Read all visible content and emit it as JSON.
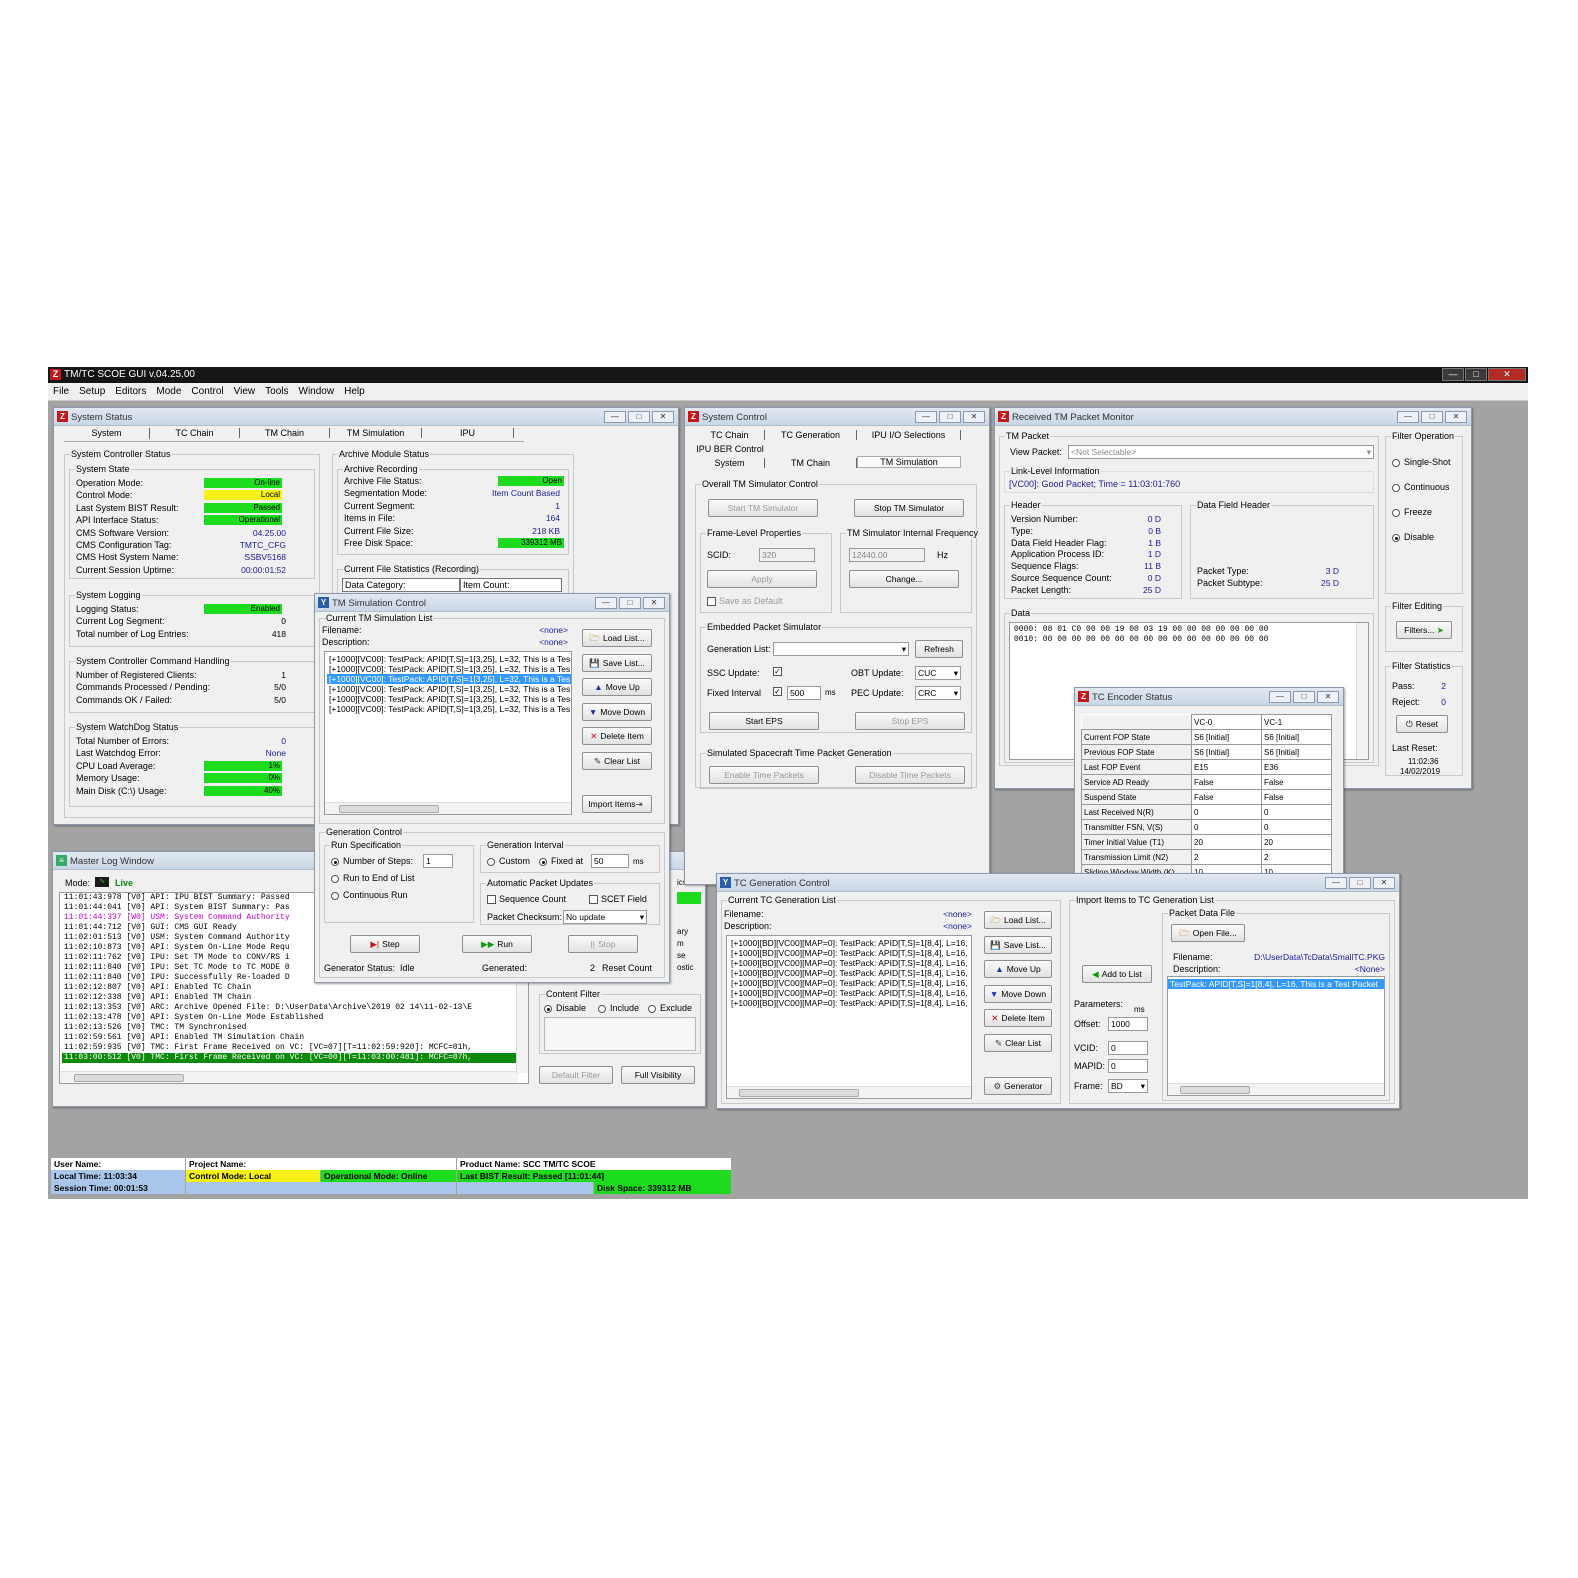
{
  "app": {
    "title": "TM/TC SCOE GUI v.04.25.00",
    "menu": [
      "File",
      "Setup",
      "Editors",
      "Mode",
      "Control",
      "View",
      "Tools",
      "Window",
      "Help"
    ],
    "window_buttons": [
      "—",
      "□",
      "✕"
    ]
  },
  "system_status": {
    "title": "System Status",
    "tabs": [
      "System",
      "TC Chain",
      "TM Chain",
      "TM Simulation",
      "IPU"
    ],
    "controller_status": "System Controller Status",
    "state_group": "System State",
    "state": [
      {
        "label": "Operation Mode:",
        "value": "On-line",
        "color": "green"
      },
      {
        "label": "Control Mode:",
        "value": "Local",
        "color": "yellow"
      },
      {
        "label": "Last System BIST Result:",
        "value": "Passed",
        "color": "green"
      },
      {
        "label": "API Interface Status:",
        "value": "Operational",
        "color": "green"
      },
      {
        "label": "CMS Software Version:",
        "value": "04.25.00",
        "color": ""
      },
      {
        "label": "CMS Configuration Tag:",
        "value": "TMTC_CFG",
        "color": ""
      },
      {
        "label": "CMS Host System Name:",
        "value": "SSBV5168",
        "color": ""
      },
      {
        "label": "Current Session Uptime:",
        "value": "00:00:01:52",
        "color": ""
      }
    ],
    "logging_group": "System Logging",
    "logging": [
      {
        "label": "Logging Status:",
        "value": "Enabled",
        "color": "green"
      },
      {
        "label": "Current Log Segment:",
        "value": "0",
        "color": ""
      },
      {
        "label": "Total number of Log Entries:",
        "value": "418",
        "color": ""
      }
    ],
    "cmd_group": "System Controller Command Handling",
    "cmd": [
      {
        "label": "Number of Registered Clients:",
        "value": "1"
      },
      {
        "label": "Commands Processed / Pending:",
        "value": "5/0"
      },
      {
        "label": "Commands OK / Failed:",
        "value": "5/0"
      }
    ],
    "watchdog_group": "System WatchDog Status",
    "watchdog": [
      {
        "label": "Total Number of Errors:",
        "value": "0",
        "color": ""
      },
      {
        "label": "Last Watchdog Error:",
        "value": "None",
        "color": ""
      },
      {
        "label": "CPU Load Average:",
        "value": "1%",
        "color": "green"
      },
      {
        "label": "Memory Usage:",
        "value": "0%",
        "color": "green"
      },
      {
        "label": "Main Disk (C:\\) Usage:",
        "value": "40%",
        "color": "green"
      }
    ],
    "archive_group": "Archive Module Status",
    "recording_group": "Archive Recording",
    "archive": [
      {
        "label": "Archive File Status:",
        "value": "Open",
        "color": "green"
      },
      {
        "label": "Segmentation Mode:",
        "value": "Item Count Based",
        "color": ""
      },
      {
        "label": "Current Segment:",
        "value": "1",
        "color": ""
      },
      {
        "label": "Items in File:",
        "value": "164",
        "color": ""
      },
      {
        "label": "Current File Size:",
        "value": "218 KB",
        "color": ""
      },
      {
        "label": "Free Disk Space:",
        "value": "339312 MB",
        "color": "green"
      }
    ],
    "file_stats_group": "Current File Statistics (Recording)",
    "file_stats_headers": [
      "Data Category:",
      "Item Count:"
    ]
  },
  "tm_sim": {
    "title": "TM Simulation Control",
    "list_group": "Current TM Simulation List",
    "filename_label": "Filename:",
    "filename": "<none>",
    "description_label": "Description:",
    "description": "<none>",
    "rows": [
      "[+1000][VC00]: TestPack: APID[T,S]=1[3,25], L=32, This is a Tes",
      "[+1000][VC00]: TestPack: APID[T,S]=1[3,25], L=32, This is a Tes",
      "[+1000][VC00]: TestPack: APID[T,S]=1[3,25], L=32, This is a Tes",
      "[+1000][VC00]: TestPack: APID[T,S]=1[3,25], L=32, This is a Tes",
      "[+1000][VC00]: TestPack: APID[T,S]=1[3,25], L=32, This is a Tes",
      "[+1000][VC00]: TestPack: APID[T,S]=1[3,25], L=32, This is a Tes"
    ],
    "buttons": [
      "Load List...",
      "Save List...",
      "Move Up",
      "Move Down",
      "Delete Item",
      "Clear List",
      "Import Items"
    ],
    "gen_group": "Generation Control",
    "run_spec_group": "Run Specification",
    "run_opts": [
      "Number of Steps:",
      "Run to End of List",
      "Continuous Run"
    ],
    "steps": "1",
    "interval_group": "Generation Interval",
    "interval_custom": "Custom",
    "interval_fixed": "Fixed at",
    "interval_value": "50",
    "interval_unit": "ms",
    "auto_group": "Automatic Packet Updates",
    "seq_count": "Sequence Count",
    "scet_field": "SCET Field",
    "checksum_label": "Packet Checksum:",
    "checksum": "No update",
    "step": "Step",
    "run": "Run",
    "stop": "Stop",
    "gen_status_label": "Generator Status:",
    "gen_status": "Idle",
    "generated_label": "Generated:",
    "generated": "2",
    "reset_count": "Reset Count"
  },
  "master_log": {
    "title": "Master Log Window",
    "mode_label": "Mode:",
    "mode": "Live",
    "lines": [
      {
        "t": "11:01:43:978 [V0] API: IPU BIST Summary: Passed",
        "c": ""
      },
      {
        "t": "11:01:44:041 [V0] API: System BIST Summary: Pas",
        "c": ""
      },
      {
        "t": "11:01:44:337 [W0] USM: System Command Authority",
        "c": "magenta"
      },
      {
        "t": "11:01:44:712 [V0] GUI: CMS GUI Ready",
        "c": ""
      },
      {
        "t": "11:02:01:513 [V0] USM: System Command Authority",
        "c": ""
      },
      {
        "t": "11:02:10:873 [V0] API: System On-Line Mode Requ",
        "c": ""
      },
      {
        "t": "11:02:11:762 [V0] IPU: Set TM Mode to CONV/RS i",
        "c": ""
      },
      {
        "t": "11:02:11:840 [V0] IPU: Set TC Mode to TC MODE 0",
        "c": ""
      },
      {
        "t": "11:02:11:840 [V0] IPU: Successfully Re-loaded D",
        "c": ""
      },
      {
        "t": "11:02:12:807 [V0] API: Enabled TC Chain",
        "c": ""
      },
      {
        "t": "11:02:12:338 [V0] API: Enabled TM Chain",
        "c": ""
      },
      {
        "t": "11:02:13:353 [V0] ARC: Archive Opened File: D:\\UserData\\Archive\\2019 02 14\\11-02-13\\E",
        "c": ""
      },
      {
        "t": "11:02:13:478 [V0] API: System On-Line Mode Established",
        "c": ""
      },
      {
        "t": "11:02:13:526 [V0] TMC: TM Synchronised",
        "c": ""
      },
      {
        "t": "11:02:59:561 [V0] API: Enabled TM Simulation Chain",
        "c": ""
      },
      {
        "t": "11:02:59:935 [V0] TMC: First Frame Received on VC: [VC=07][T=11:02:59:920]: MCFC=01h,",
        "c": ""
      },
      {
        "t": "11:03:00:512 [V0] TMC: First Frame Received on VC: [VC=00][T=11:03:00:481]: MCFC=07h,",
        "c": "hl"
      }
    ],
    "side_labels": [
      "ics",
      "ary",
      "m",
      "se",
      "ostic"
    ],
    "content_filter_group": "Content Filter",
    "filter_opts": [
      "Disable",
      "Include",
      "Exclude"
    ],
    "default_filter": "Default Filter",
    "full_visibility": "Full Visibility"
  },
  "system_control": {
    "title": "System Control",
    "tabs_row1": [
      "TC Chain",
      "TC Generation",
      "IPU I/O Selections"
    ],
    "tabs_row2": [
      "IPU BER Control"
    ],
    "tabs_row3": [
      "System",
      "TM Chain",
      "TM Simulation"
    ],
    "overall_group": "Overall TM Simulator Control",
    "start_sim": "Start TM Simulator",
    "stop_sim": "Stop TM Simulator",
    "frame_group": "Frame-Level Properties",
    "scid_label": "SCID:",
    "scid": "320",
    "apply": "Apply",
    "save_default": "Save as Default",
    "freq_group": "TM Simulator Internal Frequency",
    "freq": "12440.00",
    "freq_unit": "Hz",
    "change": "Change...",
    "eps_group": "Embedded Packet Simulator",
    "gen_list_label": "Generation List:",
    "refresh": "Refresh",
    "ssc_label": "SSC Update:",
    "obt_label": "OBT Update:",
    "obt": "CUC",
    "fixed_interval_label": "Fixed Interval",
    "fixed_interval": "500",
    "fixed_interval_unit": "ms",
    "pec_label": "PEC Update:",
    "pec": "CRC",
    "start_eps": "Start EPS",
    "stop_eps": "Stop EPS",
    "time_group": "Simulated Spacecraft Time Packet Generation",
    "enable_time": "Enable Time Packets",
    "disable_time": "Disable Time Packets"
  },
  "tm_monitor": {
    "title": "Received TM Packet Monitor",
    "tm_packet_group": "TM Packet",
    "view_packet_label": "View Packet:",
    "view_packet": "<Not Selectable>",
    "link_group": "Link-Level Information",
    "link_info": "[VC00]: Good Packet; Time = 11:03:01:760",
    "header_group": "Header",
    "header": [
      {
        "label": "Version Number:",
        "value": "0 D"
      },
      {
        "label": "Type:",
        "value": "0 B"
      },
      {
        "label": "Data Field Header Flag:",
        "value": "1 B"
      },
      {
        "label": "Application Process ID:",
        "value": "1 D"
      },
      {
        "label": "Sequence Flags:",
        "value": "11 B"
      },
      {
        "label": "Source Sequence Count:",
        "value": "0 D"
      },
      {
        "label": "Packet Length:",
        "value": "25 D"
      }
    ],
    "dfh_group": "Data Field Header",
    "packet_type_label": "Packet Type:",
    "packet_type": "3 D",
    "packet_subtype_label": "Packet Subtype:",
    "packet_subtype": "25 D",
    "data_group": "Data",
    "data_lines": [
      "0000:  08 01 C0 00 00 19 00 03 19 00 00 00 00 00 00 00",
      "0010:  00 00 00 00 00 00 00 00 00 00 00 00 00 00 00 00"
    ],
    "filter_op_group": "Filter Operation",
    "filter_ops": [
      "Single-Shot",
      "Continuous",
      "Freeze",
      "Disable"
    ],
    "filter_edit_group": "Filter Editing",
    "filters": "Filters...",
    "filter_stats_group": "Filter Statistics",
    "pass_label": "Pass:",
    "pass": "2",
    "reject_label": "Reject:",
    "reject": "0",
    "reset": "Reset",
    "last_reset_label": "Last Reset:",
    "last_reset_time": "11:02:36",
    "last_reset_date": "14/02/2019"
  },
  "tc_encoder": {
    "title": "TC Encoder Status",
    "cols": [
      "VC-0",
      "VC-1"
    ],
    "rows": [
      [
        "Current FOP State",
        "S6 [Initial]",
        "S6 [Initial]"
      ],
      [
        "Previous FOP State",
        "S6 [Initial]",
        "S6 [Initial]"
      ],
      [
        "Last FOP Event",
        "E15",
        "E36"
      ],
      [
        "Service AD Ready",
        "False",
        "False"
      ],
      [
        "Suspend State",
        "False",
        "False"
      ],
      [
        "Last Received N(R)",
        "0",
        "0"
      ],
      [
        "Transmitter FSN, V(S)",
        "0",
        "0"
      ],
      [
        "Timer Initial Value (T1)",
        "20",
        "20"
      ],
      [
        "Transmission Limit (N2)",
        "2",
        "2"
      ],
      [
        "Sliding Window Width (K)",
        "10",
        "10"
      ]
    ]
  },
  "tc_gen": {
    "title": "TC Generation Control",
    "list_group": "Current TC Generation List",
    "filename_label": "Filename:",
    "filename": "<none>",
    "description_label": "Description:",
    "description": "<none>",
    "rows": [
      "[+1000][BD][VC00][MAP=0]: TestPack: APID[T,S]=1[8,4], L=16,",
      "[+1000][BD][VC00][MAP=0]: TestPack: APID[T,S]=1[8,4], L=16,",
      "[+1000][BD][VC00][MAP=0]: TestPack: APID[T,S]=1[8,4], L=16,",
      "[+1000][BD][VC00][MAP=0]: TestPack: APID[T,S]=1[8,4], L=16,",
      "[+1000][BD][VC00][MAP=0]: TestPack: APID[T,S]=1[8,4], L=16,",
      "[+1000][BD][VC00][MAP=0]: TestPack: APID[T,S]=1[8,4], L=16,",
      "[+1000][BD][VC00][MAP=0]: TestPack: APID[T,S]=1[8,4], L=16,"
    ],
    "buttons": [
      "Load List...",
      "Save List...",
      "Move Up",
      "Move Down",
      "Delete Item",
      "Clear List",
      "Generator"
    ],
    "import_group": "Import Items to TC Generation List",
    "pdf_group": "Packet Data File",
    "open_file": "Open File...",
    "pdf_filename_label": "Filename:",
    "pdf_filename": "D:\\UserData\\TcData\\SmallTC.PKG",
    "pdf_desc_label": "Description:",
    "pdf_desc": "<None>",
    "pdf_item": "TestPack: APID[T,S]=1[8,4], L=16, This is a Test Packet",
    "add_to_list": "Add to List",
    "params_label": "Parameters:",
    "ms": "ms",
    "offset_label": "Offset:",
    "offset": "1000",
    "vcid_label": "VCID:",
    "vcid": "0",
    "mapid_label": "MAPID:",
    "mapid": "0",
    "frame_label": "Frame:",
    "frame": "BD"
  },
  "status_bar": {
    "user": "User Name:",
    "project": "Project Name:",
    "product": "Product Name: SCC TM/TC SCOE",
    "local_time": "Local Time: 11:03:34",
    "control_mode": "Control Mode: Local",
    "op_mode": "Operational Mode: Online",
    "last_bist": "Last BIST Result: Passed [11:01:44]",
    "session_time": "Session Time: 00:01:53",
    "disk_space": "Disk Space: 339312 MB"
  },
  "colors": {
    "green": "#1ddc1d",
    "yellow": "#f6f219",
    "selection": "#3399ff",
    "status_blue": "#a9c6ea",
    "log_highlight": "#0b8a0b"
  }
}
